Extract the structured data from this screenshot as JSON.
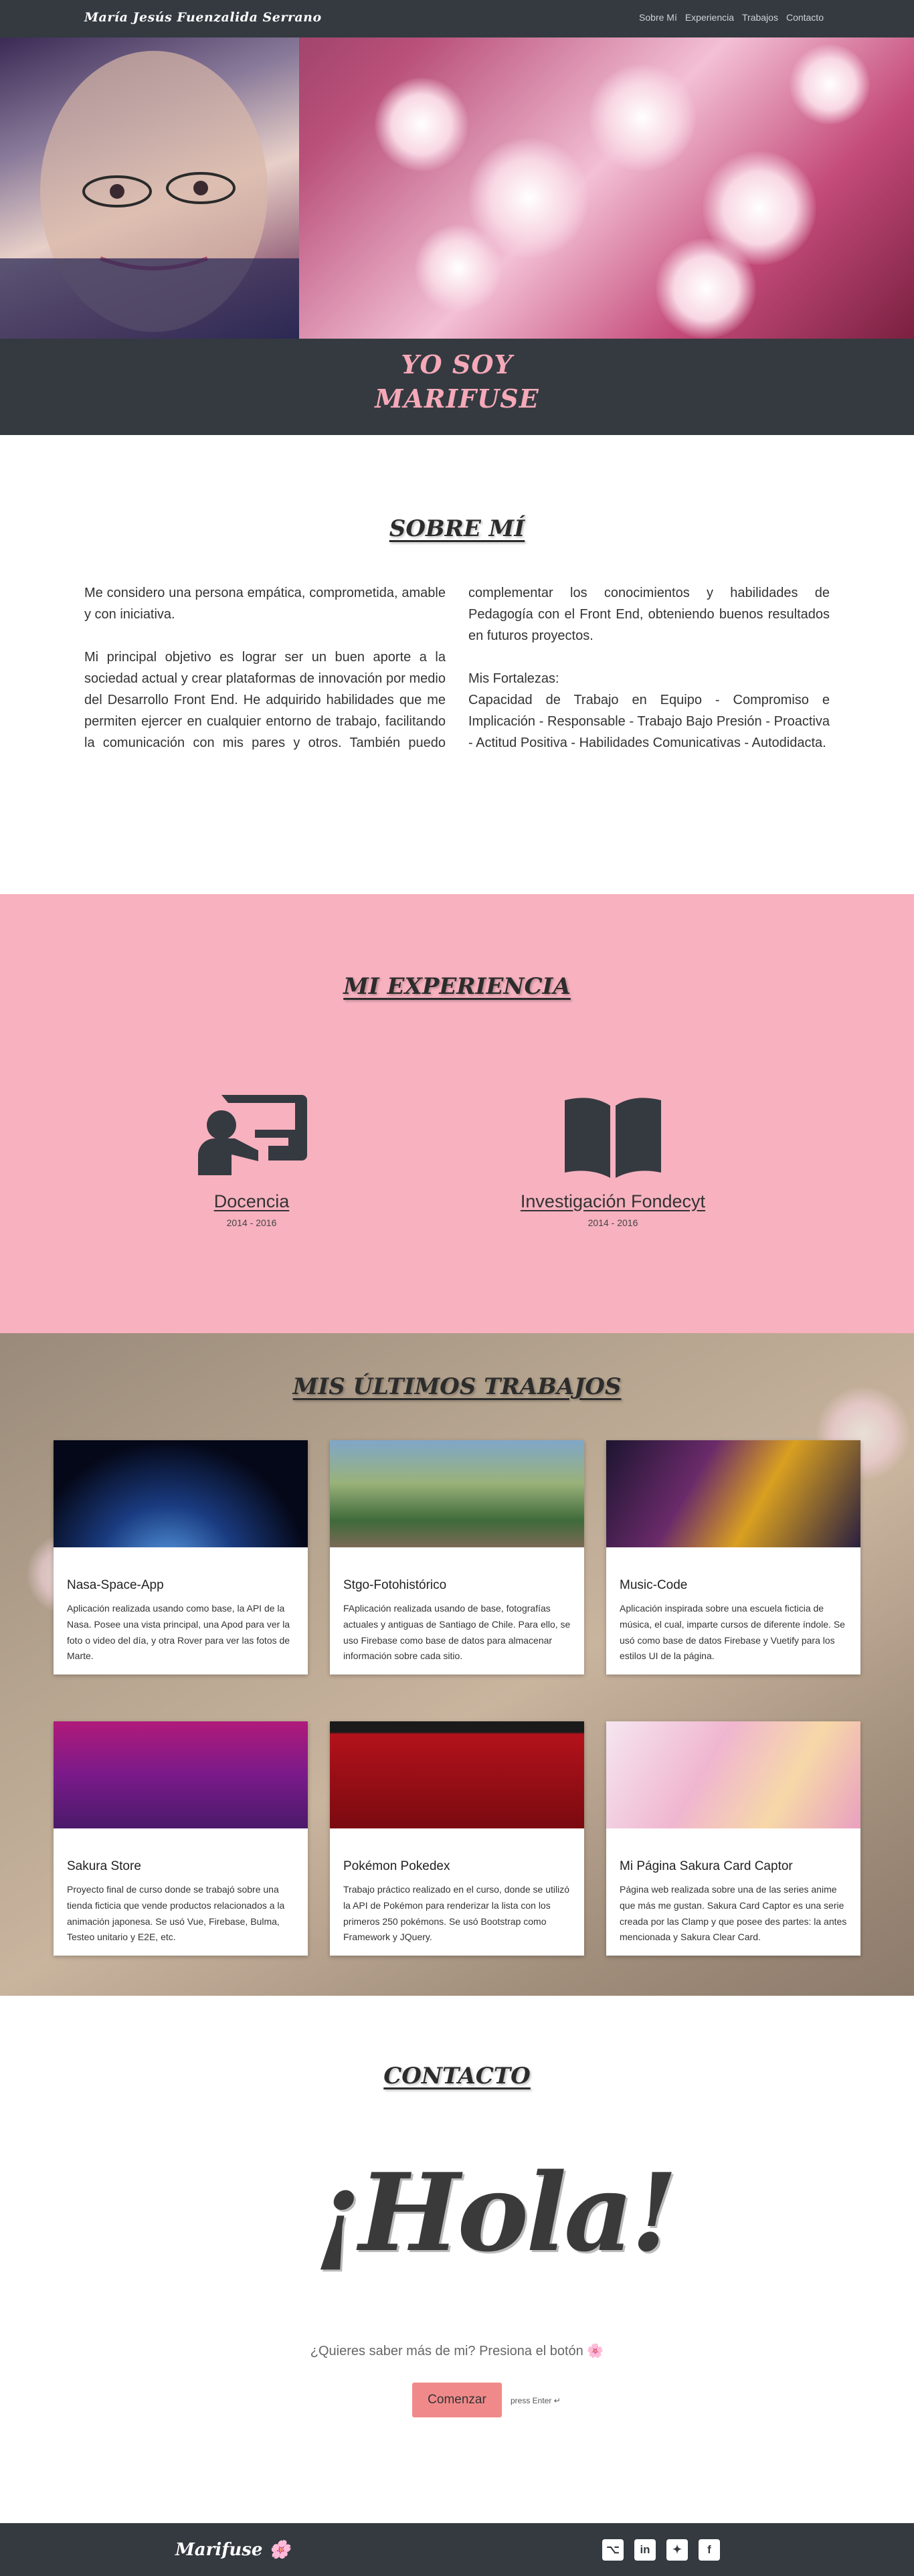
{
  "nav": {
    "brand": "María Jesús Fuenzalida Serrano",
    "links": [
      "Sobre Mí",
      "Experiencia",
      "Trabajos",
      "Contacto"
    ]
  },
  "hero": {
    "line1": "YO SOY",
    "line2": "MARIFUSE"
  },
  "about": {
    "title": "SOBRE MÍ",
    "p1": "Me considero una persona empática, comprometida, amable y con iniciativa.",
    "p2": "Mi principal objetivo es lograr ser un buen aporte a la sociedad actual y crear plataformas de innovación por medio del Desarrollo Front End. He adquirido habilidades que me permiten ejercer en cualquier entorno de trabajo, facilitando la comunicación con mis pares y otros. También puedo complementar los conocimientos y habilidades de Pedagogía con el Front End, obteniendo buenos resultados en futuros proyectos.",
    "p3": "Mis Fortalezas:",
    "p4": "Capacidad de Trabajo en Equipo - Compromiso e Implicación - Responsable - Trabajo Bajo Presión - Proactiva - Actitud Positiva - Habilidades Comunicativas - Autodidacta."
  },
  "experience": {
    "title": "MI EXPERIENCIA",
    "items": [
      {
        "name": "Docencia",
        "date": "2014 - 2016",
        "icon": "teacher-icon"
      },
      {
        "name": "Investigación Fondecyt",
        "date": "2014 - 2016",
        "icon": "book-icon"
      }
    ]
  },
  "works": {
    "title": "MIS ÚLTIMOS TRABAJOS",
    "cards": [
      {
        "title": "Nasa-Space-App",
        "desc": "Aplicación realizada usando como base, la API de la Nasa. Posee una vista principal, una Apod para ver la foto o video del día, y otra Rover para ver las fotos de Marte."
      },
      {
        "title": "Stgo-Fotohistórico",
        "desc": "FAplicación realizada usando de base, fotografías actuales y antiguas de Santiago de Chile. Para ello, se uso Firebase como base de datos para almacenar información sobre cada sitio."
      },
      {
        "title": "Music-Code",
        "desc": "Aplicación inspirada sobre una escuela ficticia de música, el cual, imparte cursos de diferente índole. Se usó como base de datos Firebase y Vuetify para los estilos UI de la página."
      },
      {
        "title": "Sakura Store",
        "desc": "Proyecto final de curso donde se trabajó sobre una tienda ficticia que vende productos relacionados a la animación japonesa. Se usó Vue, Firebase, Bulma, Testeo unitario y E2E, etc."
      },
      {
        "title": "Pokémon Pokedex",
        "desc": "Trabajo práctico realizado en el curso, donde se utilizó la API de Pokémon para renderizar la lista con los primeros 250 pokémons. Se usó Bootstrap como Framework y JQuery."
      },
      {
        "title": "Mi Página Sakura Card Captor",
        "desc": "Página web realizada sobre una de las series anime que más me gustan. Sakura Card Captor es una serie creada por las Clamp y que posee des partes: la antes mencionada y Sakura Clear Card."
      }
    ]
  },
  "contact": {
    "title": "CONTACTO",
    "hola": "¡Hola!",
    "question": "¿Quieres saber más de mi? Presiona el botón 🌸",
    "button": "Comenzar",
    "hint": "press Enter ↵"
  },
  "footer": {
    "brand": "Marifuse 🌸",
    "social": [
      "github-icon",
      "linkedin-icon",
      "twitter-icon",
      "facebook-icon"
    ]
  }
}
